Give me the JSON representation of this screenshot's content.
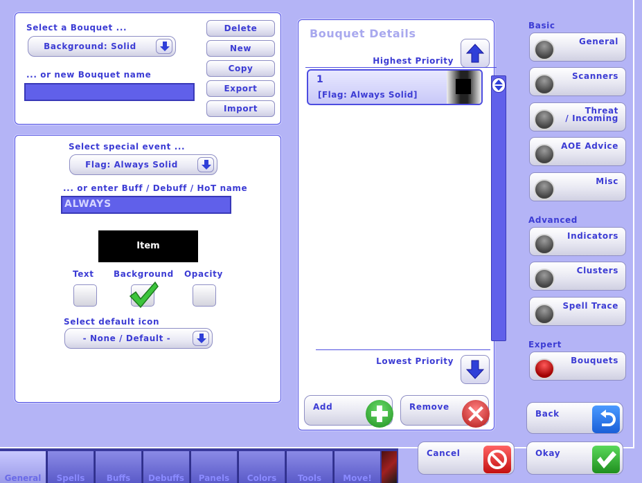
{
  "bouquet_select": {
    "label": "Select a Bouquet ...",
    "selected": "Background: Solid",
    "new_label": "... or new Bouquet name",
    "new_value": ""
  },
  "bouquet_actions": {
    "delete": "Delete",
    "new": "New",
    "copy": "Copy",
    "export": "Export",
    "import": "Import"
  },
  "event": {
    "label": "Select special event ...",
    "selected": "Flag: Always Solid",
    "name_label": "... or enter Buff / Debuff / HoT name",
    "name_value": "ALWAYS",
    "preview_text": "Item",
    "text_label": "Text",
    "background_label": "Background",
    "opacity_label": "Opacity",
    "text_checked": false,
    "background_checked": true,
    "opacity_checked": false,
    "icon_label": "Select default icon",
    "icon_selected": "- None / Default -"
  },
  "details": {
    "title": "Bouquet Details",
    "highest": "Highest Priority",
    "lowest": "Lowest Priority",
    "items": [
      {
        "number": "1",
        "name": "[Flag: Always Solid]"
      }
    ],
    "add": "Add",
    "remove": "Remove"
  },
  "sidebar": {
    "basic": "Basic",
    "advanced": "Advanced",
    "expert": "Expert",
    "general": "General",
    "scanners": "Scanners",
    "threat_1": "Threat",
    "threat_2": "/ Incoming",
    "aoe": "AOE Advice",
    "misc": "Misc",
    "indicators": "Indicators",
    "clusters": "Clusters",
    "spell_trace": "Spell Trace",
    "bouquets": "Bouquets"
  },
  "footer": {
    "back": "Back",
    "cancel": "Cancel",
    "okay": "Okay"
  },
  "tabs": [
    "General",
    "Spells",
    "Buffs",
    "Debuffs",
    "Panels",
    "Colors",
    "Tools",
    "Move!"
  ],
  "colors": {
    "accent": "#3c3cd4",
    "background": "#b4b4f6",
    "input": "#6060ea"
  }
}
